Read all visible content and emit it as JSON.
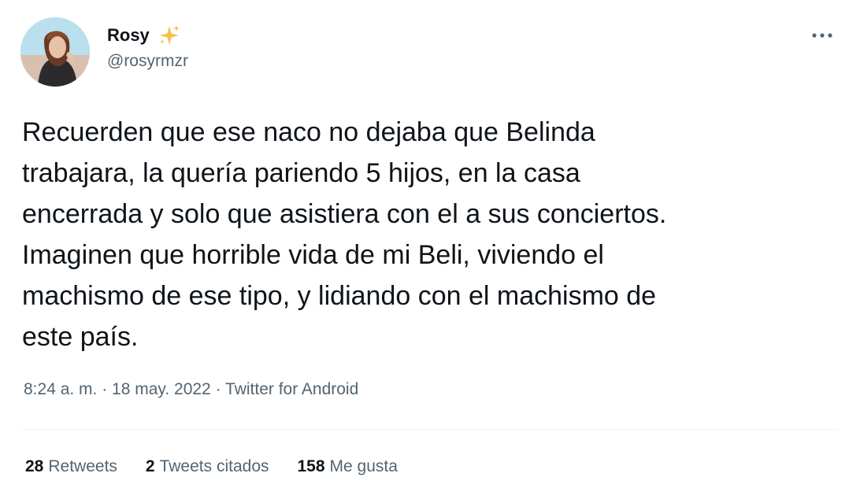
{
  "author": {
    "display_name": "Rosy",
    "emoji_icon": "sparkles-icon",
    "handle": "@rosyrmzr"
  },
  "tweet": {
    "text": "Recuerden que ese naco no dejaba que Belinda\ntrabajara, la quería pariendo 5 hijos, en la casa\nencerrada y solo que asistiera con el a sus conciertos.\nImaginen que horrible vida de mi Beli, viviendo el\nmachismo de ese tipo, y lidiando con el machismo de\neste país."
  },
  "meta": {
    "timestamp": "8:24 a. m. · 18 may. 2022 · Twitter for Android"
  },
  "stats": {
    "retweets_count": "28",
    "retweets_label": "Retweets",
    "quotes_count": "2",
    "quotes_label": "Tweets citados",
    "likes_count": "158",
    "likes_label": "Me gusta"
  },
  "colors": {
    "text_primary": "#0f1419",
    "text_secondary": "#536471",
    "divider": "#eff3f4",
    "sparkle": "#f5c242"
  }
}
